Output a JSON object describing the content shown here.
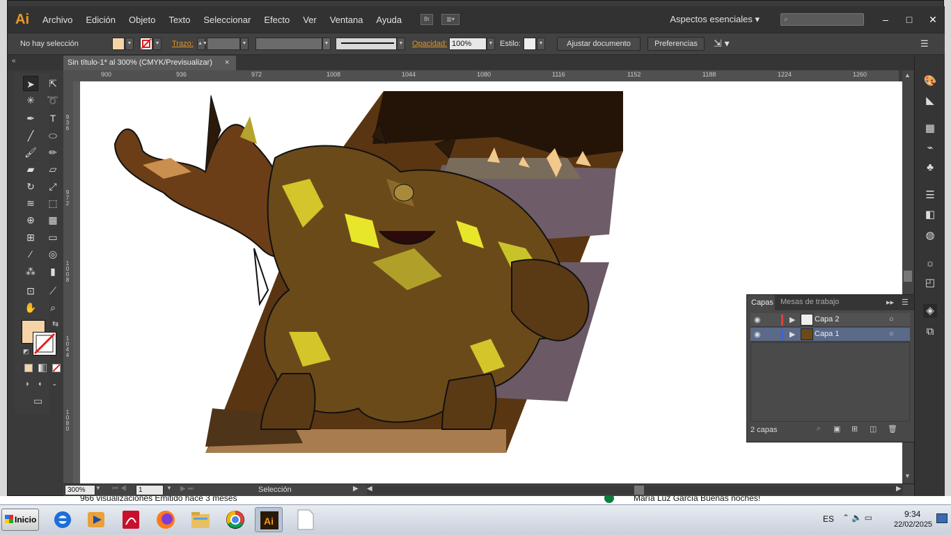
{
  "app": {
    "logo": "Ai"
  },
  "menu": [
    "Archivo",
    "Edición",
    "Objeto",
    "Texto",
    "Seleccionar",
    "Efecto",
    "Ver",
    "Ventana",
    "Ayuda"
  ],
  "menubar_buttons": {
    "bridge": "Br"
  },
  "workspace": "Aspectos esenciales",
  "window_controls": {
    "minimize": "–",
    "maximize": "□",
    "close": "✕"
  },
  "control_bar": {
    "selection": "No hay selección",
    "stroke_label": "Trazo:",
    "opacity_label": "Opacidad:",
    "opacity_value": "100%",
    "style_label": "Estilo:",
    "fit_button": "Ajustar documento",
    "prefs_button": "Preferencias"
  },
  "document_tab": {
    "title": "Sin título-1* al 300% (CMYK/Previsualizar)",
    "close": "×"
  },
  "ruler": {
    "h_ticks": [
      "900",
      "936",
      "972",
      "1008",
      "1044",
      "1080",
      "1116",
      "1152",
      "1188",
      "1224",
      "1260"
    ],
    "v_ticks": [
      "9\n3\n6",
      "9\n7\n2",
      "1\n0\n0\n8",
      "1\n0\n4\n4",
      "1\n0\n8\n0"
    ]
  },
  "layers_panel": {
    "tabs": [
      "Capas",
      "Mesas de trabajo"
    ],
    "layers": [
      {
        "name": "Capa 2",
        "color": "#e04040",
        "selected": false
      },
      {
        "name": "Capa 1",
        "color": "#4060e0",
        "selected": true
      }
    ],
    "count": "2 capas"
  },
  "status_bar": {
    "zoom": "300%",
    "page": "1",
    "tool": "Selección"
  },
  "colors": {
    "fill": "#f5d5a8",
    "accent": "#e8941d",
    "brand": "#f29a1f"
  },
  "behind_text": {
    "left": "966 visualizaciones  Emitido hace 3 meses",
    "right": "María Luz García  Buenas noches!"
  },
  "taskbar": {
    "start": "Inicio",
    "lang": "ES",
    "time": "9:34",
    "date": "22/02/2025"
  }
}
